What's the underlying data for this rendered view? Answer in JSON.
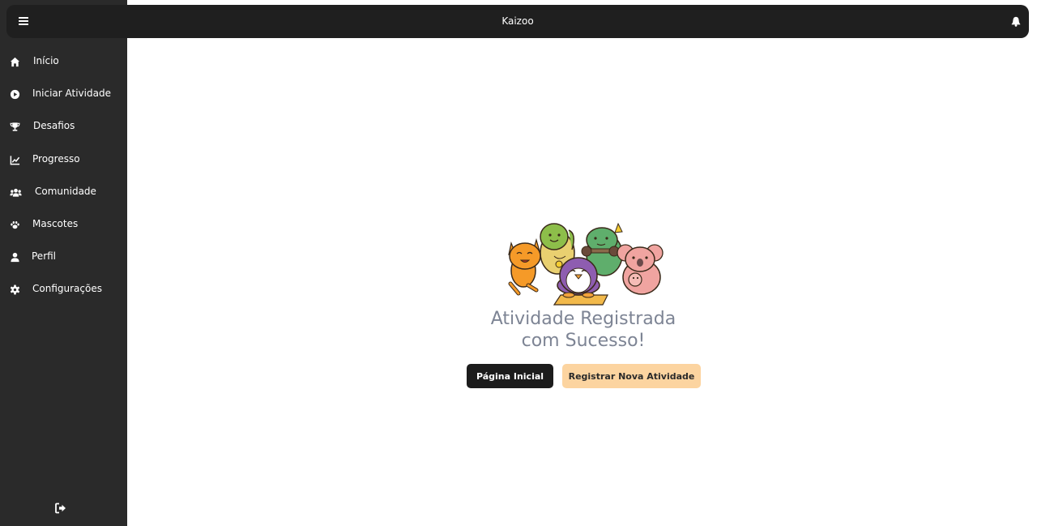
{
  "header": {
    "title": "Kaizoo"
  },
  "sidebar": {
    "items": [
      {
        "label": "Início",
        "icon": "home-icon"
      },
      {
        "label": "Iniciar Atividade",
        "icon": "play-icon"
      },
      {
        "label": "Desafios",
        "icon": "trophy-icon"
      },
      {
        "label": "Progresso",
        "icon": "chart-line-icon"
      },
      {
        "label": "Comunidade",
        "icon": "users-icon"
      },
      {
        "label": "Mascotes",
        "icon": "paw-icon"
      },
      {
        "label": "Perfil",
        "icon": "user-icon"
      },
      {
        "label": "Configurações",
        "icon": "gear-icon"
      }
    ],
    "logout_icon": "logout-icon"
  },
  "main": {
    "illustration": "mascots-illustration",
    "message_line1": "Atividade Registrada",
    "message_line2": "com Sucesso!",
    "home_button": "Página Inicial",
    "new_activity_button": "Registrar Nova Atividade"
  },
  "colors": {
    "sidebar_bg": "#2a2a2a",
    "topbar_bg": "#1f1f1f",
    "primary_button": "#1c1c1c",
    "accent_button": "#fcd4a0",
    "message_text": "#7d8494"
  }
}
